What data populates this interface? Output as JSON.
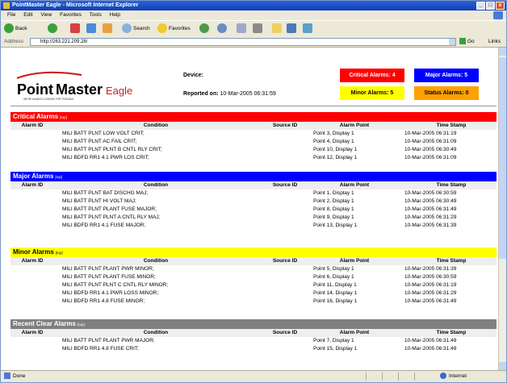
{
  "window": {
    "title": "PointMaster Eagle - Microsoft Internet Explorer",
    "btn_min": "_",
    "btn_max": "□",
    "btn_close": "x"
  },
  "menu": [
    "File",
    "Edit",
    "View",
    "Favorites",
    "Tools",
    "Help"
  ],
  "toolbar": {
    "back": "Back",
    "search": "Search",
    "favorites": "Favorites"
  },
  "address": {
    "label": "Address",
    "url": "http://263.221.209.28/",
    "go": "Go",
    "links": "Links"
  },
  "logo": {
    "point": "Point",
    "master": "Master",
    "eagle": "Eagle",
    "tagline": "WE'RE ALWAYS LOOKING FOR TROUBLE"
  },
  "header": {
    "device_label": "Device:",
    "reported_label": "Reported on:",
    "reported_value": "10-Mar-2005 06:31:59"
  },
  "summary": {
    "critical": "Critical Alarms: 4",
    "major": "Major Alarms: 5",
    "minor": "Minor Alarms: 5",
    "status": "Status Alarms: 0"
  },
  "colors": {
    "critical": "#ff0000",
    "major": "#0000ff",
    "minor": "#ffff00",
    "status": "#ffa000",
    "clear": "#808080"
  },
  "columns": {
    "id": "Alarm ID",
    "condition": "Condition",
    "source": "Source ID",
    "point": "Alarm Point",
    "time": "Time Stamp"
  },
  "sections": [
    {
      "title": "Critical Alarms",
      "top": "[top]",
      "rows": [
        [
          "MILI BATT PLNT LOW VOLT CRIT;",
          "Point 3, Display 1",
          "10-Mar-2005 06:31:19"
        ],
        [
          "MILI BATT PLNT AC FAIL CRIT;",
          "Point 4, Display 1",
          "10-Mar-2005 06:31:09"
        ],
        [
          "MILI BATT PLNT PLNT B CNTL RLY CRIT;",
          "Point 10, Display 1",
          "10-Mar-2005 06:30:49"
        ],
        [
          "MILI BDFD RR1 4.1 PWR LOS CRIT;",
          "Point 12, Display 1",
          "10-Mar-2005 06:31:09"
        ]
      ]
    },
    {
      "title": "Major Alarms",
      "top": "[top]",
      "rows": [
        [
          "MILI BATT PLNT BAT DISCHG MAJ;",
          "Point 1, Display 1",
          "10-Mar-2005 06:30:59"
        ],
        [
          "MILI BATT PLNT HI VOLT MAJ;",
          "Point 2, Display 1",
          "10-Mar-2005 06:30:49"
        ],
        [
          "MILI BATT PLNT PLANT FUSE MAJOR;",
          "Point 8, Display 1",
          "10-Mar-2005 06:31:49"
        ],
        [
          "MILI BATT PLNT PLNT A CNTL RLY MAJ;",
          "Point 9, Display 1",
          "10-Mar-2005 06:31:29"
        ],
        [
          "MILI BDFD RR1 4.1 FUSE MAJOR;",
          "Point 13, Display 1",
          "10-Mar-2005 06:31:39"
        ]
      ]
    },
    {
      "title": "Minor Alarms",
      "top": "[top]",
      "rows": [
        [
          "MILI BATT PLNT PLANT PWR MINOR;",
          "Point 5, Display 1",
          "10-Mar-2005 06:31:39"
        ],
        [
          "MILI BATT PLNT PLANT FUSE MINOR;",
          "Point 6, Display 1",
          "10-Mar-2005 06:30:59"
        ],
        [
          "MILI BATT PLNT PLNT C CNTL RLY MINOR;",
          "Point 11, Display 1",
          "10-Mar-2005 06:31:19"
        ],
        [
          "MILI BDFD RR1 4.1 PWR LOSS MINOR;",
          "Point 14, Display 1",
          "10-Mar-2005 06:31:29"
        ],
        [
          "MILI BDFD RR1 4.8 FUSE MINOR;",
          "Point 16, Display 1",
          "10-Mar-2005 06:31:49"
        ]
      ]
    },
    {
      "title": "Recent Clear Alarms",
      "top": "[top]",
      "rows": [
        [
          "MILI BATT PLNT PLANT PWR MAJOR;",
          "Point 7, Display 1",
          "10-Mar-2005 06:31:49"
        ],
        [
          "MILI BDFD RR1 4.8 FUSE CRIT;",
          "Point 15, Display 1",
          "10-Mar-2005 06:31:49"
        ]
      ]
    }
  ],
  "status": {
    "left": "Done",
    "zone": "Internet"
  }
}
